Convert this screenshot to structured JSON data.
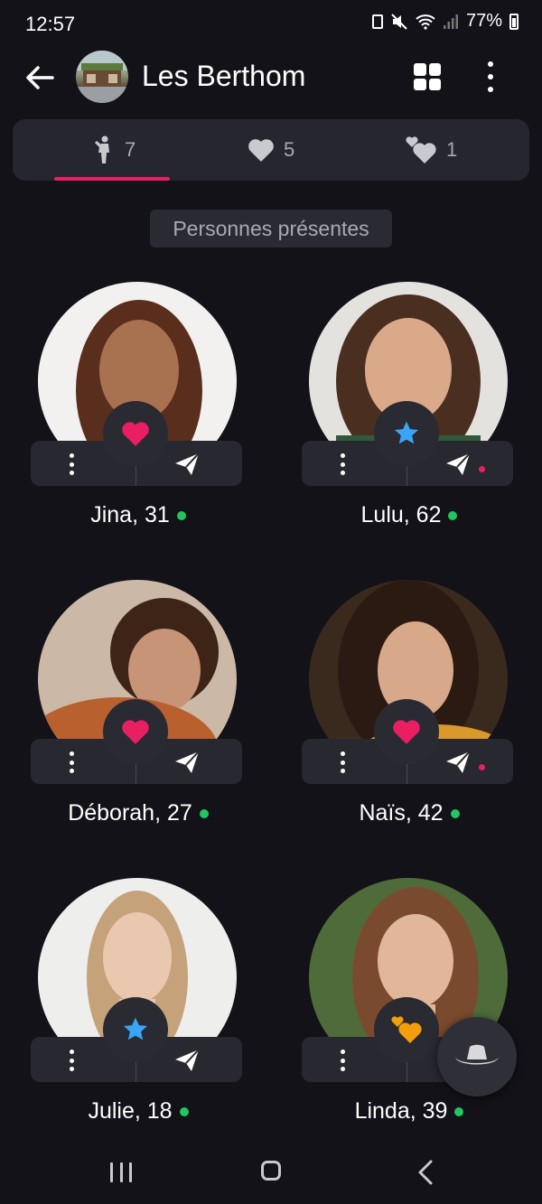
{
  "status_bar": {
    "time": "12:57",
    "battery": "77%"
  },
  "header": {
    "title": "Les Berthom",
    "icons": [
      "back-arrow-icon",
      "venue-avatar",
      "grid-view-icon",
      "more-vert-icon"
    ]
  },
  "tabs": [
    {
      "icon": "person-standing-icon",
      "count": "7"
    },
    {
      "icon": "heart-icon",
      "count": "5"
    },
    {
      "icon": "hearts-icon",
      "count": "1"
    }
  ],
  "section_label": "Personnes présentes",
  "people": [
    {
      "name": "Jina, 31",
      "badge": "heart"
    },
    {
      "name": "Lulu, 62",
      "badge": "star"
    },
    {
      "name": "Déborah, 27",
      "badge": "heart"
    },
    {
      "name": "Naïs, 42",
      "badge": "heart"
    },
    {
      "name": "Julie, 18",
      "badge": "star"
    },
    {
      "name": "Linda, 39",
      "badge": "hearts"
    }
  ],
  "colors": {
    "accent": "#e91e63",
    "online": "#22c55e",
    "star": "#3ba5f5",
    "orange_hearts": "#f59e0b",
    "background": "#121218",
    "surface": "#26262f"
  }
}
